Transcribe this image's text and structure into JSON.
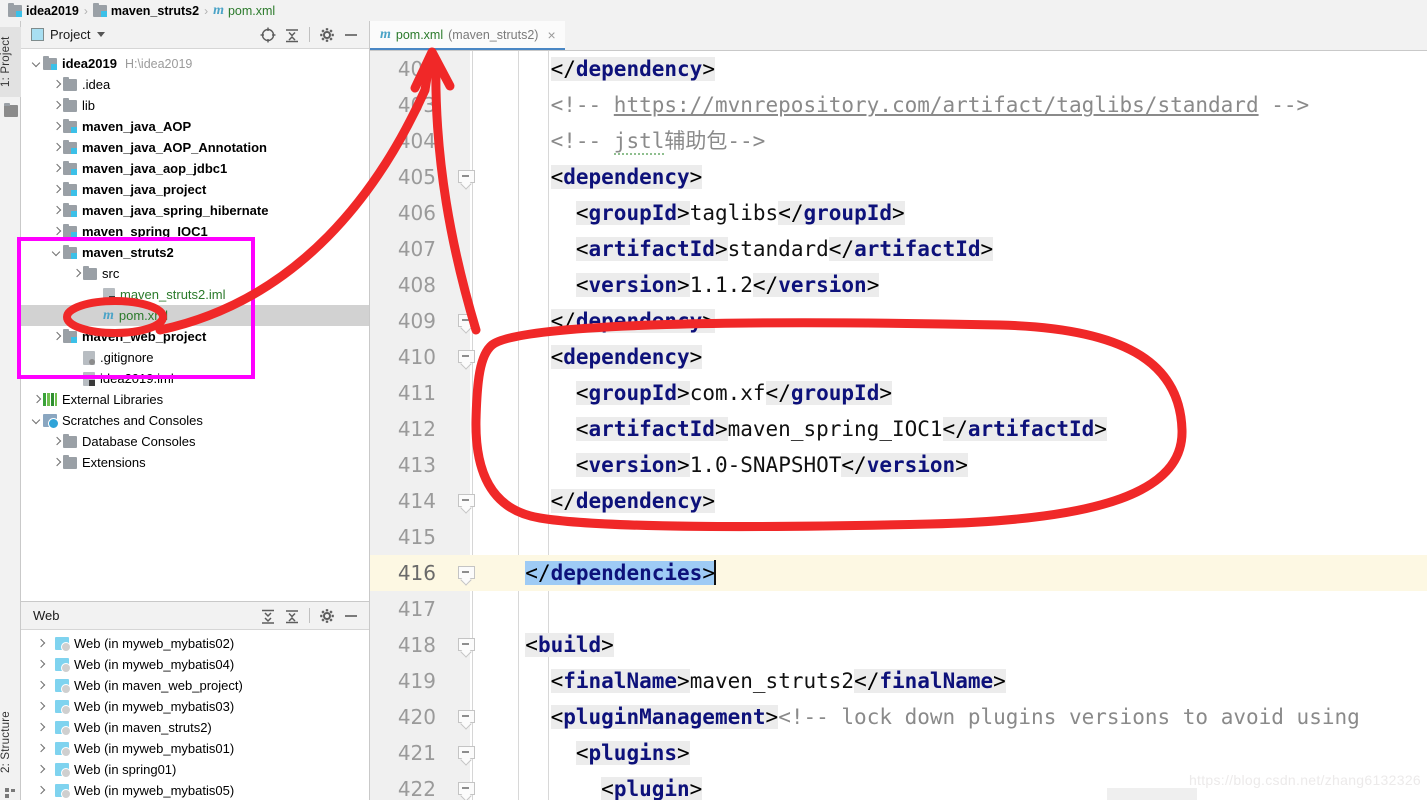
{
  "breadcrumb": {
    "items": [
      {
        "label": "idea2019",
        "icon": "folder-module-icon",
        "bold": true
      },
      {
        "label": "maven_struts2",
        "icon": "folder-module-icon",
        "bold": true
      },
      {
        "label": "pom.xml",
        "icon": "maven-m-icon",
        "bold": false
      }
    ],
    "separator": "›"
  },
  "left_stripe": {
    "project_label": "1: Project",
    "structure_label": "2: Structure"
  },
  "project_panel": {
    "title": "Project",
    "icons": [
      "locate-target-icon",
      "collapse-all-icon",
      "gear-icon",
      "hide-icon"
    ],
    "tree": [
      {
        "indent": 0,
        "arrow": "down",
        "icon": "folder-module-icon",
        "label": "idea2019",
        "bold": true,
        "path": "H:\\idea2019"
      },
      {
        "indent": 1,
        "arrow": "right",
        "icon": "folder-icon",
        "label": ".idea",
        "bold": false
      },
      {
        "indent": 1,
        "arrow": "right",
        "icon": "folder-icon",
        "label": "lib",
        "bold": false
      },
      {
        "indent": 1,
        "arrow": "right",
        "icon": "folder-module-icon",
        "label": "maven_java_AOP",
        "bold": true
      },
      {
        "indent": 1,
        "arrow": "right",
        "icon": "folder-module-icon",
        "label": "maven_java_AOP_Annotation",
        "bold": true
      },
      {
        "indent": 1,
        "arrow": "right",
        "icon": "folder-module-icon",
        "label": "maven_java_aop_jdbc1",
        "bold": true
      },
      {
        "indent": 1,
        "arrow": "right",
        "icon": "folder-module-icon",
        "label": "maven_java_project",
        "bold": true
      },
      {
        "indent": 1,
        "arrow": "right",
        "icon": "folder-module-icon",
        "label": "maven_java_spring_hibernate",
        "bold": true
      },
      {
        "indent": 1,
        "arrow": "right",
        "icon": "folder-module-icon",
        "label": "maven_spring_IOC1",
        "bold": true
      },
      {
        "indent": 1,
        "arrow": "down",
        "icon": "folder-module-icon",
        "label": "maven_struts2",
        "bold": true
      },
      {
        "indent": 2,
        "arrow": "right",
        "icon": "folder-icon",
        "label": "src",
        "bold": false
      },
      {
        "indent": 3,
        "arrow": "none",
        "icon": "iml-file-icon",
        "label": "maven_struts2.iml",
        "bold": false,
        "green": true
      },
      {
        "indent": 3,
        "arrow": "none",
        "icon": "maven-m-icon",
        "label": "pom.xml",
        "bold": false,
        "green": true,
        "selected": true
      },
      {
        "indent": 1,
        "arrow": "right",
        "icon": "folder-module-icon",
        "label": "maven_web_project",
        "bold": true
      },
      {
        "indent": 2,
        "arrow": "none",
        "icon": "gitignore-file-icon",
        "label": ".gitignore",
        "bold": false
      },
      {
        "indent": 2,
        "arrow": "none",
        "icon": "iml-file-icon",
        "label": "idea2019.iml",
        "bold": false
      },
      {
        "indent": 0,
        "arrow": "right",
        "icon": "external-libraries-icon",
        "label": "External Libraries",
        "bold": false
      },
      {
        "indent": 0,
        "arrow": "down",
        "icon": "scratches-icon",
        "label": "Scratches and Consoles",
        "bold": false
      },
      {
        "indent": 1,
        "arrow": "right",
        "icon": "folder-icon",
        "label": "Database Consoles",
        "bold": false
      },
      {
        "indent": 1,
        "arrow": "right",
        "icon": "folder-icon",
        "label": "Extensions",
        "bold": false
      }
    ]
  },
  "web_panel": {
    "title": "Web",
    "icons": [
      "expand-all-icon",
      "collapse-all-icon",
      "gear-icon",
      "hide-icon"
    ],
    "items": [
      {
        "label": "Web (in myweb_mybatis02)"
      },
      {
        "label": "Web (in myweb_mybatis04)"
      },
      {
        "label": "Web (in maven_web_project)"
      },
      {
        "label": "Web (in myweb_mybatis03)"
      },
      {
        "label": "Web (in maven_struts2)"
      },
      {
        "label": "Web (in myweb_mybatis01)"
      },
      {
        "label": "Web (in spring01)"
      },
      {
        "label": "Web (in myweb_mybatis05)"
      }
    ]
  },
  "editor": {
    "tab": {
      "icon": "maven-m-icon",
      "name": "pom.xml",
      "module": "(maven_struts2)",
      "close": "×"
    },
    "current_line": 416,
    "lines": [
      {
        "n": 402,
        "fold": false,
        "indent_guides": 1,
        "segments": [
          {
            "t": "indent",
            "w": 2
          },
          {
            "t": "tag_close",
            "name": "dependency"
          }
        ]
      },
      {
        "n": 403,
        "fold": false,
        "indent_guides": 1,
        "segments": [
          {
            "t": "indent",
            "w": 2
          },
          {
            "t": "comment_link",
            "pre": "<!-- ",
            "link": "https://mvnrepository.com/artifact/taglibs/standard",
            "post": " -->"
          }
        ]
      },
      {
        "n": 404,
        "fold": false,
        "indent_guides": 1,
        "segments": [
          {
            "t": "indent",
            "w": 2
          },
          {
            "t": "comment_squiggle",
            "pre": "<!-- ",
            "sq": "jstl",
            "post": "辅助包-->"
          }
        ]
      },
      {
        "n": 405,
        "fold": true,
        "indent_guides": 1,
        "segments": [
          {
            "t": "indent",
            "w": 2
          },
          {
            "t": "tag_open",
            "name": "dependency"
          }
        ]
      },
      {
        "n": 406,
        "fold": false,
        "indent_guides": 2,
        "segments": [
          {
            "t": "indent",
            "w": 3
          },
          {
            "t": "element",
            "name": "groupId",
            "value": "taglibs"
          }
        ]
      },
      {
        "n": 407,
        "fold": false,
        "indent_guides": 2,
        "segments": [
          {
            "t": "indent",
            "w": 3
          },
          {
            "t": "element",
            "name": "artifactId",
            "value": "standard"
          }
        ]
      },
      {
        "n": 408,
        "fold": false,
        "indent_guides": 2,
        "segments": [
          {
            "t": "indent",
            "w": 3
          },
          {
            "t": "element",
            "name": "version",
            "value": "1.1.2"
          }
        ]
      },
      {
        "n": 409,
        "fold": true,
        "indent_guides": 1,
        "segments": [
          {
            "t": "indent",
            "w": 2
          },
          {
            "t": "tag_close",
            "name": "dependency"
          }
        ]
      },
      {
        "n": 410,
        "fold": true,
        "indent_guides": 1,
        "segments": [
          {
            "t": "indent",
            "w": 2
          },
          {
            "t": "tag_open",
            "name": "dependency"
          }
        ]
      },
      {
        "n": 411,
        "fold": false,
        "indent_guides": 2,
        "segments": [
          {
            "t": "indent",
            "w": 3
          },
          {
            "t": "element",
            "name": "groupId",
            "value": "com.xf"
          }
        ]
      },
      {
        "n": 412,
        "fold": false,
        "indent_guides": 2,
        "segments": [
          {
            "t": "indent",
            "w": 3
          },
          {
            "t": "element",
            "name": "artifactId",
            "value": "maven_spring_IOC1"
          }
        ]
      },
      {
        "n": 413,
        "fold": false,
        "indent_guides": 2,
        "segments": [
          {
            "t": "indent",
            "w": 3
          },
          {
            "t": "element",
            "name": "version",
            "value": "1.0-SNAPSHOT"
          }
        ]
      },
      {
        "n": 414,
        "fold": true,
        "indent_guides": 1,
        "segments": [
          {
            "t": "indent",
            "w": 2
          },
          {
            "t": "tag_close",
            "name": "dependency"
          }
        ]
      },
      {
        "n": 415,
        "fold": false,
        "indent_guides": 1,
        "segments": []
      },
      {
        "n": 416,
        "fold": true,
        "indent_guides": 0,
        "current": true,
        "segments": [
          {
            "t": "indent",
            "w": 1
          },
          {
            "t": "tag_close_selected",
            "name": "dependencies"
          }
        ]
      },
      {
        "n": 417,
        "fold": false,
        "indent_guides": 0,
        "segments": []
      },
      {
        "n": 418,
        "fold": true,
        "indent_guides": 0,
        "segments": [
          {
            "t": "indent",
            "w": 1
          },
          {
            "t": "tag_open",
            "name": "build"
          }
        ]
      },
      {
        "n": 419,
        "fold": false,
        "indent_guides": 1,
        "segments": [
          {
            "t": "indent",
            "w": 2
          },
          {
            "t": "element",
            "name": "finalName",
            "value": "maven_struts2"
          }
        ]
      },
      {
        "n": 420,
        "fold": true,
        "indent_guides": 1,
        "segments": [
          {
            "t": "indent",
            "w": 2
          },
          {
            "t": "tag_open",
            "name": "pluginManagement"
          },
          {
            "t": "comment",
            "text": "<!-- lock down plugins versions to avoid using"
          }
        ]
      },
      {
        "n": 421,
        "fold": true,
        "indent_guides": 2,
        "segments": [
          {
            "t": "indent",
            "w": 3
          },
          {
            "t": "tag_open",
            "name": "plugins"
          }
        ]
      },
      {
        "n": 422,
        "fold": true,
        "indent_guides": 3,
        "segments": [
          {
            "t": "indent",
            "w": 4
          },
          {
            "t": "tag_open",
            "name": "plugin"
          }
        ]
      }
    ]
  },
  "annotations": {
    "magenta_box_color": "#ff00ff",
    "red_ink_color": "#f02828",
    "shapes": [
      "magenta-rectangle-around-maven-struts2",
      "red-ellipse-around-pom-xml",
      "red-arrow-to-editor-tab",
      "red-ellipse-around-ioc1-dependency"
    ]
  },
  "watermark": {
    "text": "https://blog.csdn.net/zhang6132326"
  }
}
